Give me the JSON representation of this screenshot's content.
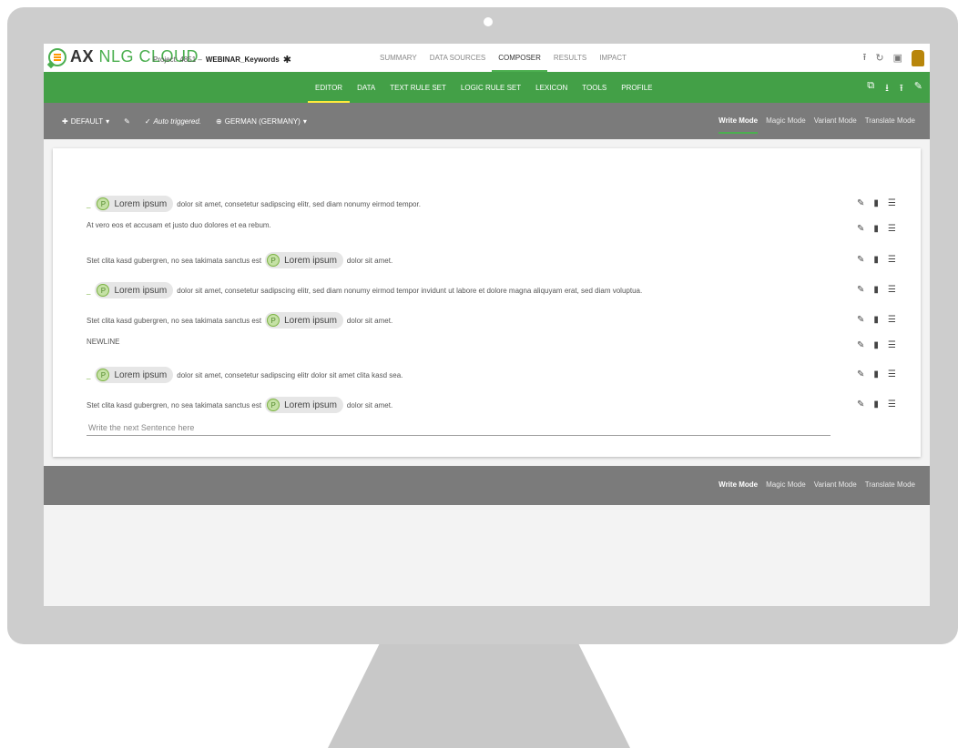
{
  "app": {
    "logo_bold": "AX",
    "logo_light": "NLG CLOUD"
  },
  "project": {
    "prefix": "Project: 4851 – ",
    "name": "WEBINAR_Keywords"
  },
  "top_nav": [
    "SUMMARY",
    "DATA SOURCES",
    "COMPOSER",
    "RESULTS",
    "IMPACT"
  ],
  "top_nav_active": "COMPOSER",
  "green_nav": [
    "EDITOR",
    "DATA",
    "TEXT RULE SET",
    "LOGIC RULE SET",
    "LEXICON",
    "TOOLS",
    "PROFILE"
  ],
  "green_nav_active": "EDITOR",
  "toolbar": {
    "default_label": "DEFAULT",
    "auto_label": "Auto triggered.",
    "language_label": "GERMAN (GERMANY)"
  },
  "modes": [
    "Write Mode",
    "Magic Mode",
    "Variant Mode",
    "Translate Mode"
  ],
  "modes_active": "Write Mode",
  "chip_letter": "P",
  "sentences": [
    {
      "chip": "Lorem ipsum",
      "before": "",
      "after": "dolor sit amet, consetetur sadipscing elitr, sed diam nonumy eirmod tempor."
    },
    {
      "chip": null,
      "text": "At vero eos et accusam et justo duo dolores et ea rebum."
    },
    {
      "chip": "Lorem ipsum",
      "before": "Stet clita kasd gubergren, no sea takimata sanctus est",
      "after": "dolor sit amet."
    },
    {
      "chip": "Lorem ipsum",
      "before": "",
      "after": "dolor sit amet, consetetur sadipscing elitr, sed diam nonumy eirmod tempor invidunt ut labore et dolore magna aliquyam erat, sed diam voluptua."
    },
    {
      "chip": "Lorem ipsum",
      "before": "Stet clita kasd gubergren, no sea takimata sanctus est",
      "after": "dolor sit amet."
    },
    {
      "chip": null,
      "text": "NEWLINE"
    },
    {
      "chip": "Lorem ipsum",
      "before": "",
      "after": "dolor sit amet, consetetur sadipscing elitr dolor sit amet clita kasd sea."
    },
    {
      "chip": "Lorem ipsum",
      "before": "Stet clita kasd gubergren, no sea takimata sanctus est",
      "after": "dolor sit amet."
    }
  ],
  "next_sentence_placeholder": "Write the next Sentence here",
  "colors": {
    "green": "#43a047",
    "toolbar_gray": "#7b7b7b",
    "chip_green": "#7cb342"
  }
}
